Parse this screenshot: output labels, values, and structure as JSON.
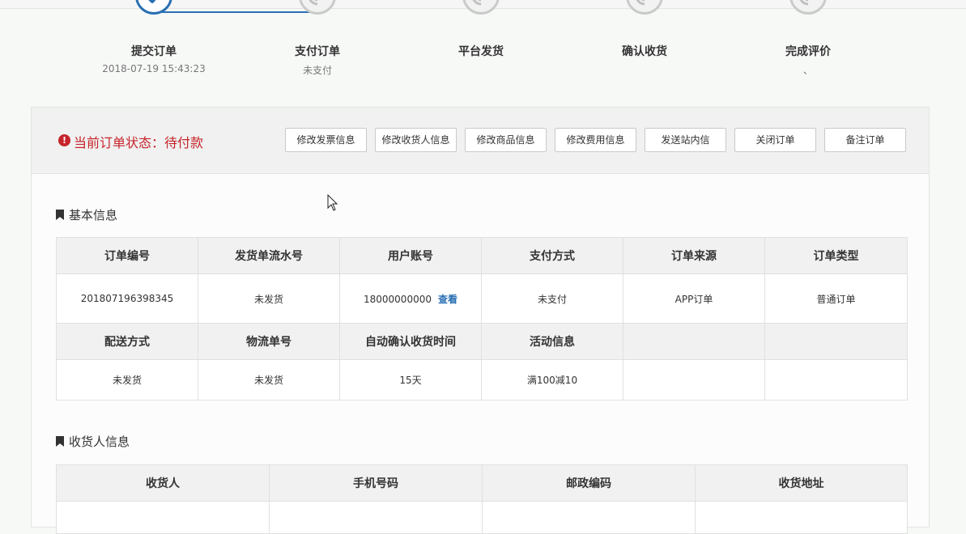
{
  "steps": [
    {
      "label": "提交订单",
      "sub": "2018-07-19 15:43:23",
      "state": "done"
    },
    {
      "label": "支付订单",
      "sub": "未支付",
      "state": "pending"
    },
    {
      "label": "平台发货",
      "sub": "",
      "state": "pending"
    },
    {
      "label": "确认收货",
      "sub": "",
      "state": "pending"
    },
    {
      "label": "完成评价",
      "sub": "、",
      "state": "pending"
    }
  ],
  "status": {
    "icon": "alert-circle-icon",
    "text": "当前订单状态：待付款",
    "color": "#c6242b"
  },
  "actions": [
    "修改发票信息",
    "修改收货人信息",
    "修改商品信息",
    "修改费用信息",
    "发送站内信",
    "关闭订单",
    "备注订单"
  ],
  "basic_info": {
    "title": "基本信息",
    "row1_headers": [
      "订单编号",
      "发货单流水号",
      "用户账号",
      "支付方式",
      "订单来源",
      "订单类型"
    ],
    "row1_values": [
      "201807196398345",
      "未发货",
      "18000000000",
      "未支付",
      "APP订单",
      "普通订单"
    ],
    "view_link": "查看",
    "row2_headers": [
      "配送方式",
      "物流单号",
      "自动确认收货时间",
      "活动信息",
      "",
      ""
    ],
    "row2_values": [
      "未发货",
      "未发货",
      "15天",
      "满100减10",
      "",
      ""
    ]
  },
  "receiver_info": {
    "title": "收货人信息",
    "headers": [
      "收货人",
      "手机号码",
      "邮政编码",
      "收货地址"
    ]
  },
  "colors": {
    "accent": "#2a6fb3",
    "alert": "#c6242b",
    "header_bg": "#f0f1f0"
  }
}
